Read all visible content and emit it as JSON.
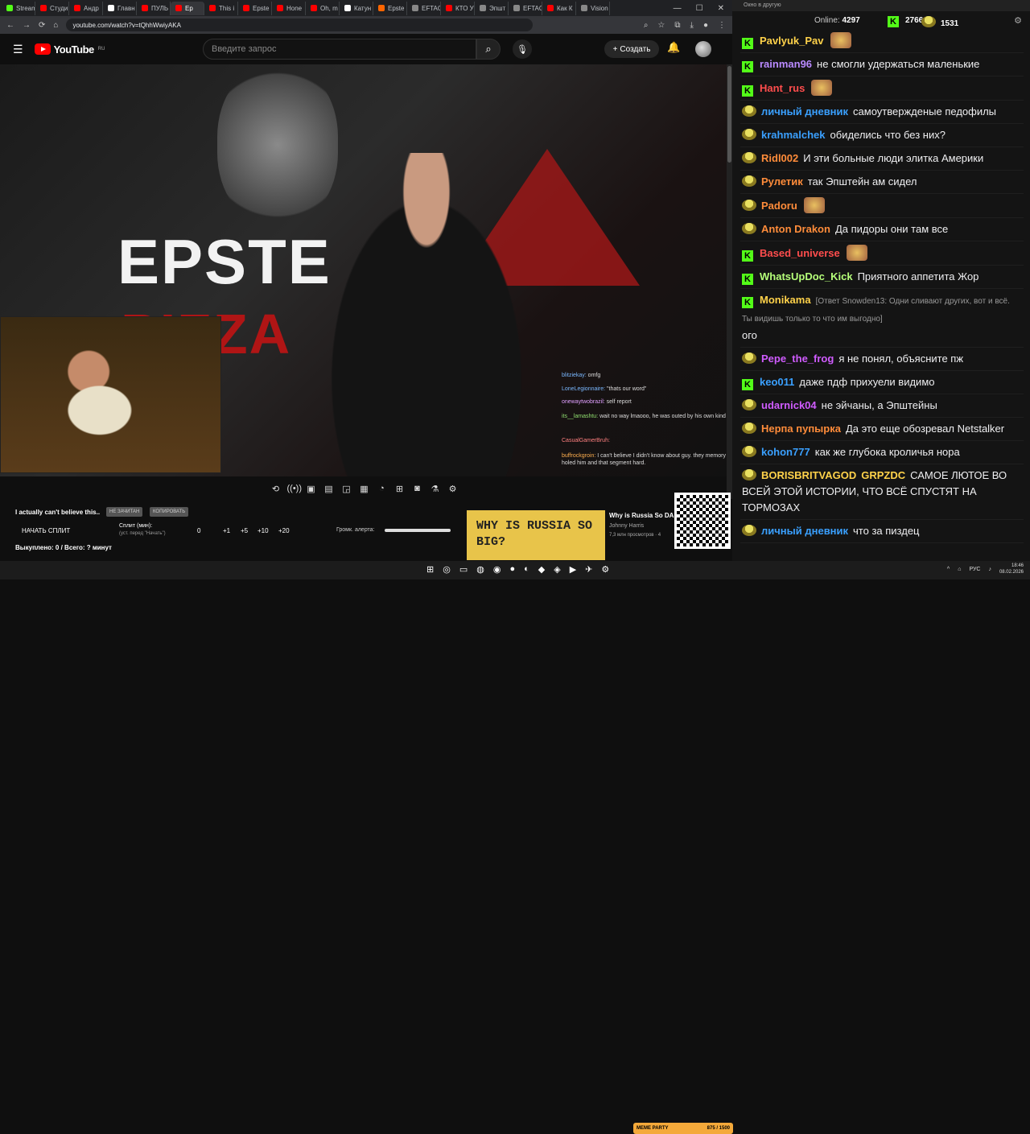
{
  "browser": {
    "tabs": [
      "Stream",
      "Студи",
      "Андр",
      "Главн",
      "ПУЛЬ",
      "Ep",
      "This i",
      "Epste",
      "Hone",
      "Oh, m",
      "Катун",
      "Epste",
      "EFTAO",
      "КТО У",
      "Эпшт",
      "EFTAO",
      "Как К",
      "Vision"
    ],
    "tab_colors": [
      "#53fc18",
      "#f00",
      "#f00",
      "#fff",
      "#f00",
      "#f00",
      "#f00",
      "#f00",
      "#f00",
      "#f00",
      "#fff",
      "#f60",
      "#888",
      "#f00",
      "#888",
      "#888",
      "#f00",
      "#888"
    ],
    "url": "youtube.com/watch?v=tQhhWwiyAKA"
  },
  "youtube": {
    "logo": "YouTube",
    "region": "RU",
    "search_placeholder": "Введите запрос",
    "create_label": "Создать"
  },
  "video": {
    "title_overlay_1": "EPSTE",
    "title_overlay_2": "PIZZA"
  },
  "video_chat": [
    {
      "user": "blitziekay:",
      "text": " omfg",
      "color": "#7ab8ff"
    },
    {
      "user": "LoneLegionnaire:",
      "text": " \"thats our word\"",
      "color": "#7ab8ff"
    },
    {
      "user": "onewaytwobrazil:",
      "text": " self report",
      "color": "#e0a0ff"
    },
    {
      "user": "its__lamashtu:",
      "text": " wait no way lmaooo, he was outed by his own kind",
      "color": "#90e070"
    },
    {
      "user": "CasualGamerBruh:",
      "text": "",
      "color": "#ff8080"
    },
    {
      "user": "buffrockgroin:",
      "text": " I can't believe I didn't know about guy. they memory holed him and that segment hard.",
      "color": "#ffb050"
    }
  ],
  "bottom_panel": {
    "message": "I actually can't believe this..",
    "pill1": "НЕ ЗАЧИТАН",
    "pill2": "КОПИРОВАТЬ",
    "split_button": "НАЧАТЬ СПЛИТ",
    "split_label": "Сплит (мин):",
    "split_hint": "(уст. перед \"Начать\")",
    "split_values": [
      "0",
      "+1",
      "+5",
      "+10",
      "+20"
    ],
    "volume_label": "Громк. алерта:",
    "total": "Выкуплено: 0 / Всего: ? минут"
  },
  "ad": {
    "thumb_text": "WHY IS RUSSIA SO BIG?",
    "title": "Why is Russia So DA",
    "author": "Johnny Harris",
    "views": "7,3 млн просмотров · 4"
  },
  "chat_window": {
    "title": "Окно в другую",
    "online_label": "Online:",
    "online_count": "4297",
    "kick_count": "2766",
    "other_count": "1531"
  },
  "chat_messages": [
    {
      "badge": "k",
      "user": "Pavlyuk_Pav",
      "color": "#ffd24a",
      "text": ""
    },
    {
      "badge": "k",
      "user": "rainman96",
      "color": "#b98aff",
      "text": "не смогли удержаться маленькие"
    },
    {
      "badge": "k",
      "user": "Hant_rus",
      "color": "#ff4d4d",
      "text": ""
    },
    {
      "badge": "p",
      "user": "личный дневник",
      "color": "#3aa0ff",
      "text": "самоутвержденые педофилы"
    },
    {
      "badge": "p",
      "user": "krahmalchek",
      "color": "#3aa0ff",
      "text": "обиделись что без них?"
    },
    {
      "badge": "p",
      "user": "Ridl002",
      "color": "#ff8c3a",
      "text": "И эти больные люди элитка Америки"
    },
    {
      "badge": "p",
      "user": "Рулетик",
      "color": "#ff8c3a",
      "text": "так Эпштейн ам сидел"
    },
    {
      "badge": "p",
      "user": "Padoru",
      "color": "#ff8c3a",
      "text": ""
    },
    {
      "badge": "p",
      "user": "Anton Drakon",
      "color": "#ff8c3a",
      "text": "Да пидоры они там все"
    },
    {
      "badge": "k",
      "user": "Based_universe",
      "color": "#ff4d4d",
      "text": ""
    },
    {
      "badge": "k",
      "user": "WhatsUpDoc_Kick",
      "color": "#b6ff7a",
      "text": "Приятного аппетита Жор"
    },
    {
      "badge": "k",
      "user": "Monikama",
      "color": "#ffd24a",
      "text": "ого",
      "reply": "[Ответ Snowden13: Одни сливают других, вот и всё. Ты видишь только то что им выгодно]"
    },
    {
      "badge": "p",
      "user": "Pepe_the_frog",
      "color": "#d05cff",
      "text": "я не понял, объясните пж"
    },
    {
      "badge": "k",
      "user": "keo011",
      "color": "#3aa0ff",
      "text": "даже пдф прихуели видимо"
    },
    {
      "badge": "p",
      "user": "udarnick04",
      "color": "#d05cff",
      "text": "не эйчаны, а Эпштейны"
    },
    {
      "badge": "p",
      "user": "Нерпа пупырка",
      "color": "#ff8c3a",
      "text": "Да это еще обозревал Netstalker"
    },
    {
      "badge": "p",
      "user": "kohon777",
      "color": "#3aa0ff",
      "text": "как же глубока кроличья нора"
    },
    {
      "badge": "p",
      "user": "BORISBRITVAGOD",
      "color": "#ffd24a",
      "text": "САМОЕ ЛЮТОЕ ВО ВСЕЙ ЭТОЙ ИСТОРИИ, ЧТО ВСЁ СПУСТЯТ НА ТОРМОЗАХ",
      "extra": "GRPZDC"
    },
    {
      "badge": "p",
      "user": "личный дневник",
      "color": "#3aa0ff",
      "text": "что за пиздец"
    }
  ],
  "taskbar": {
    "lang": "РУС",
    "time": "18:46",
    "date": "08.02.2026",
    "meme_party": "MEME PARTY",
    "meme_count": "875 / 1500"
  }
}
